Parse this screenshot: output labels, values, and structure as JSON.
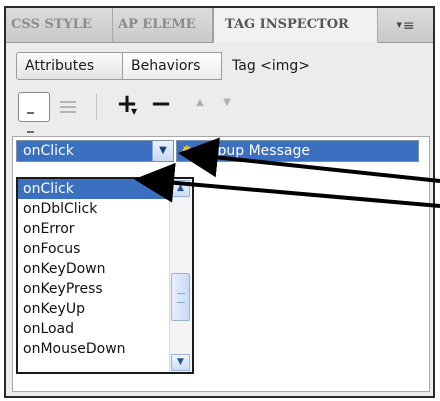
{
  "tabs": [
    {
      "label": "CSS STYLE",
      "active": false
    },
    {
      "label": "AP ELEME",
      "active": false
    },
    {
      "label": "TAG INSPECTOR",
      "active": true
    }
  ],
  "panel_menu_icon": "panel-options-icon",
  "subtabs": {
    "attributes": "Attributes",
    "behaviors": "Behaviors",
    "tag": "Tag <img>"
  },
  "toolbar": {
    "show_set_events": "show-set-events-icon",
    "show_all_events": "show-all-events-icon",
    "add": "+",
    "remove": "−",
    "up": "▲",
    "down": "▼"
  },
  "behavior_row": {
    "event": "onClick",
    "action": "Popup Message",
    "action_icon": "behavior-gear-icon"
  },
  "event_options": [
    "onClick",
    "onDblClick",
    "onError",
    "onFocus",
    "onKeyDown",
    "onKeyPress",
    "onKeyUp",
    "onLoad",
    "onMouseDown"
  ],
  "selected_event_index": 0,
  "colors": {
    "selection": "#3b6fbf",
    "panel_bg": "#ececec",
    "arrow": "#000000"
  }
}
